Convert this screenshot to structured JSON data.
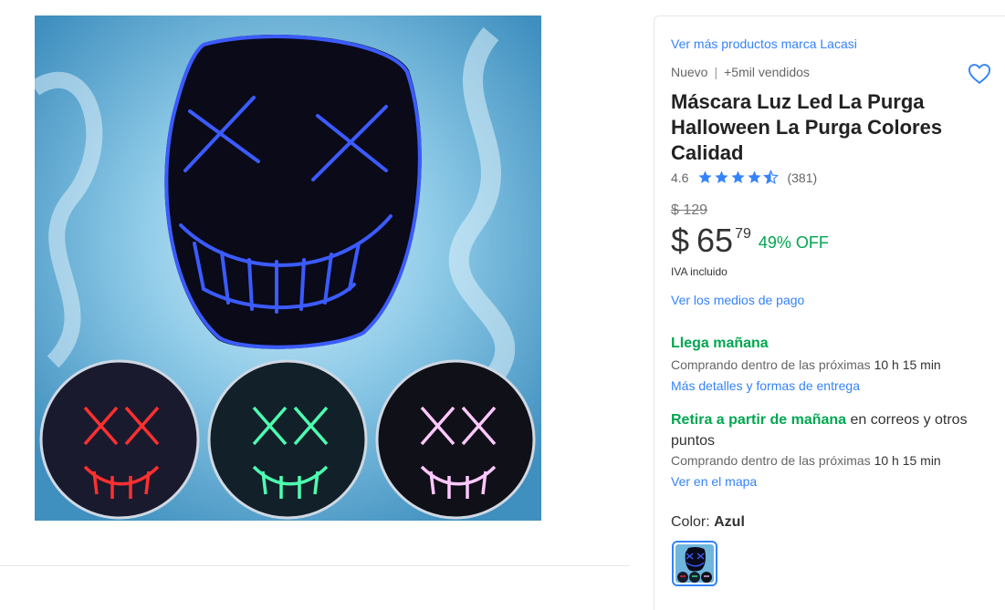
{
  "product": {
    "brand_link": "Ver más productos marca Lacasi",
    "condition": "Nuevo",
    "separator": "|",
    "sold": "+5mil vendidos",
    "title": "Máscara Luz Led La Purga Halloween La Purga Colores Calidad",
    "rating_value": "4.6",
    "rating_stars": 4.6,
    "review_count": "(381)",
    "icons": {
      "favorite": "heart-icon",
      "star": "star-icon",
      "half_star": "star-half-icon"
    }
  },
  "pricing": {
    "old_price": "$ 129",
    "currency": "$",
    "price_int": "65",
    "price_cents": "79",
    "discount": "49% OFF",
    "tax_note": "IVA incluido",
    "payment_link": "Ver los medios de pago"
  },
  "shipping": {
    "arrival_title": "Llega mañana",
    "arrival_sub_prefix": "Comprando dentro de las próximas",
    "arrival_time": "10 h 15 min",
    "arrival_link": "Más detalles y formas de entrega",
    "pickup_title": "Retira a partir de mañana",
    "pickup_rest": " en correos y otros puntos",
    "pickup_sub_prefix": "Comprando dentro de las próximas",
    "pickup_time": "10 h 15 min",
    "pickup_link": "Ver en el mapa"
  },
  "variant": {
    "label": "Color: ",
    "selected": "Azul"
  },
  "colors": {
    "link": "#3483fa",
    "green": "#00a650",
    "star": "#3483fa"
  }
}
